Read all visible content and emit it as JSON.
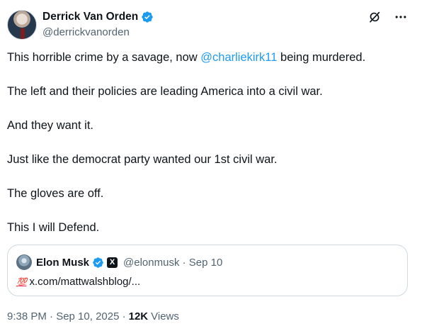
{
  "author": {
    "display_name": "Derrick Van Orden",
    "handle": "@derrickvanorden",
    "verified_color": "#1d9bf0"
  },
  "actions": {
    "grok_icon": "grok-icon",
    "more_icon": "more-options-icon"
  },
  "tweet": {
    "line1_before": "This horrible crime by a savage, now ",
    "line1_mention": "@charliekirk11",
    "line1_after": " being murdered.",
    "line2": "The left and their policies are leading America into a civil war.",
    "line3": "And they want it.",
    "line4": "Just like the democrat party wanted our 1st civil war.",
    "line5": "The gloves are off.",
    "line6": "This I will Defend."
  },
  "quote": {
    "display_name": "Elon Musk",
    "badge": "X",
    "handle_date": "@elonmusk · Sep 10",
    "emoji": "💯",
    "text": "x.com/mattwalshblog/..."
  },
  "meta": {
    "time_date": "9:38 PM · Sep 10, 2025 ·",
    "views_count": "12K",
    "views_label": "Views"
  },
  "colors": {
    "link": "#1d9bf0",
    "secondary_text": "#536471",
    "primary_text": "#0f1419"
  }
}
